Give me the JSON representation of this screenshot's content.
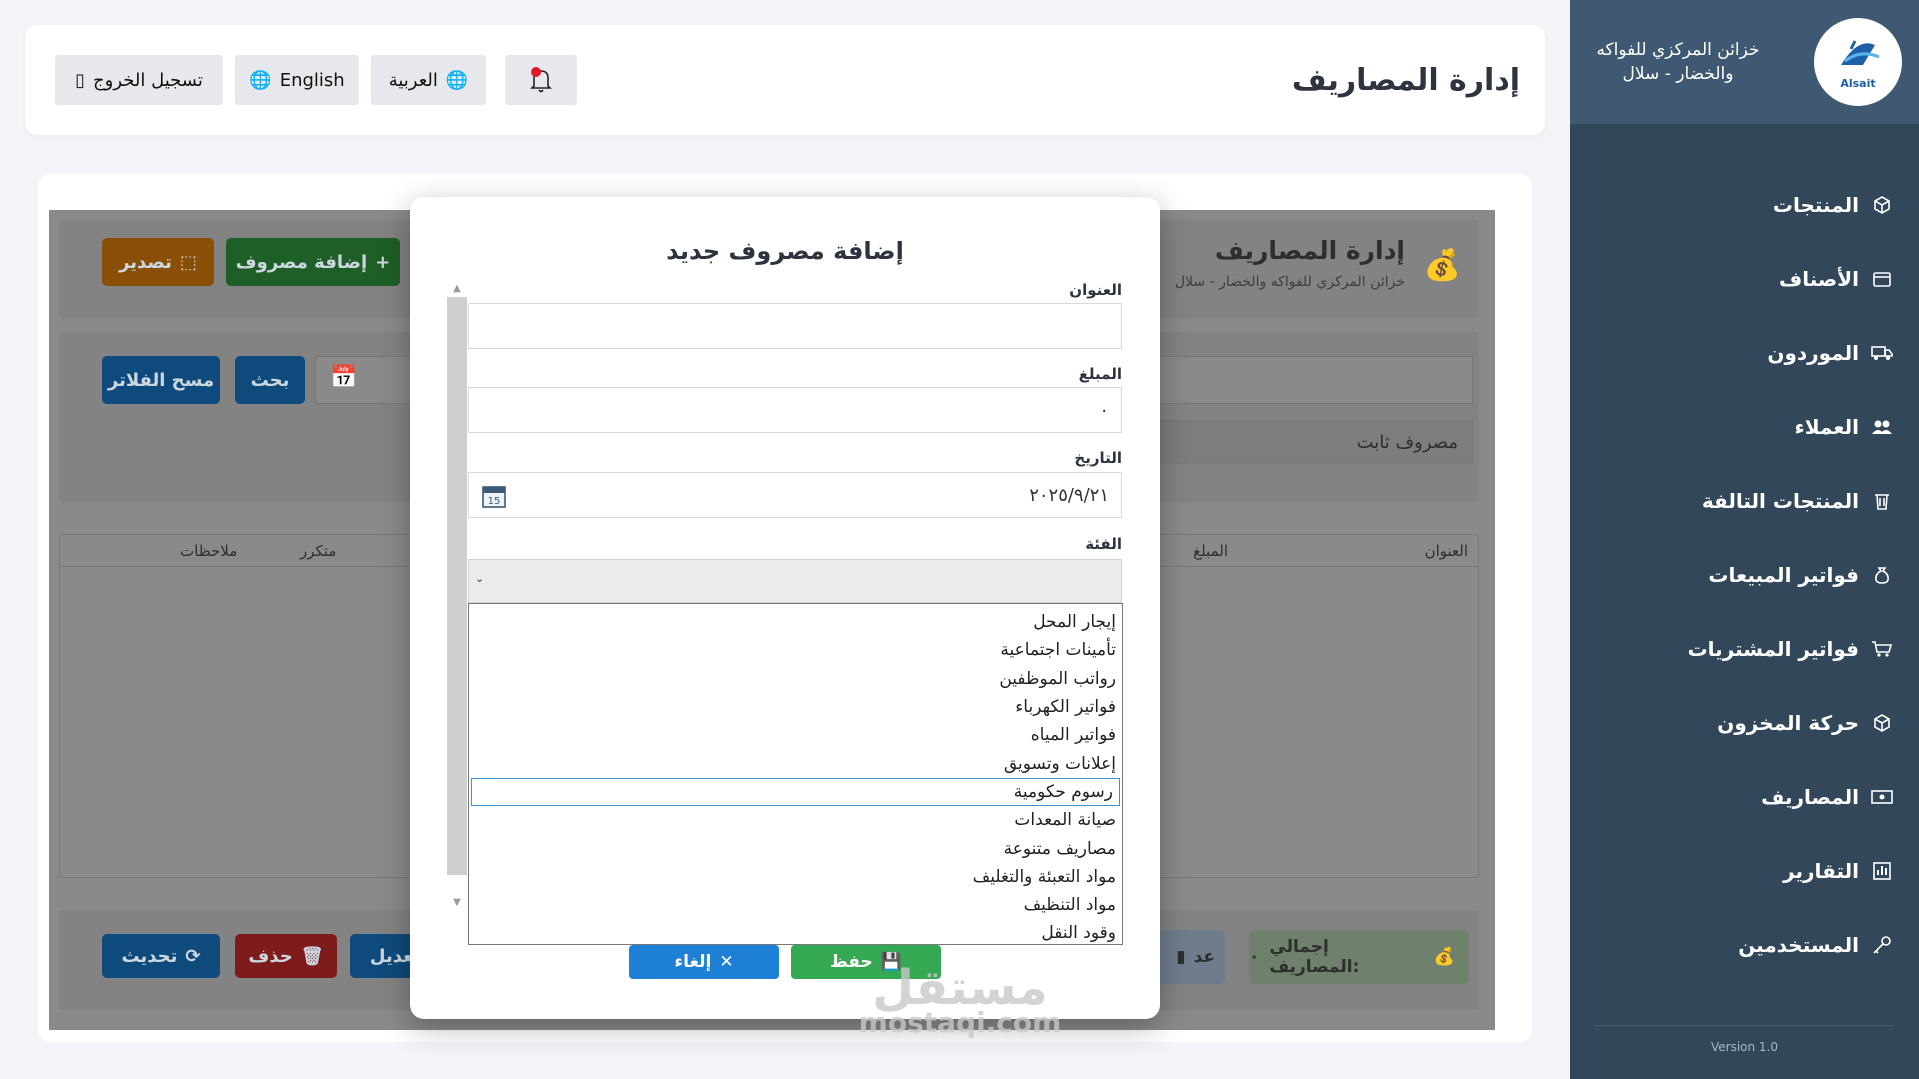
{
  "sidebar": {
    "brand": "خزائن المركزي للفواكه والخضار - سلال",
    "logo_text": "Alsait",
    "items": [
      {
        "label": "المنتجات",
        "icon": "box-icon"
      },
      {
        "label": "الأصناف",
        "icon": "folder-icon"
      },
      {
        "label": "الموردون",
        "icon": "truck-icon"
      },
      {
        "label": "العملاء",
        "icon": "users-icon"
      },
      {
        "label": "المنتجات التالفة",
        "icon": "trash-icon"
      },
      {
        "label": "فواتير المبيعات",
        "icon": "money-bag-icon"
      },
      {
        "label": "فواتير المشتريات",
        "icon": "cart-icon"
      },
      {
        "label": "حركة المخزون",
        "icon": "box-icon"
      },
      {
        "label": "المصاريف",
        "icon": "cash-icon"
      },
      {
        "label": "التقارير",
        "icon": "bar-chart-icon"
      },
      {
        "label": "المستخدمين",
        "icon": "key-icon"
      }
    ],
    "version": "Version 1.0"
  },
  "header": {
    "title": "إدارة المصاريف",
    "logout_label": "تسجيل الخروج",
    "english_label": "English",
    "arabic_label": "العربية"
  },
  "background": {
    "title": "إدارة المصاريف",
    "subtitle": "خزائن المركزي للفواكه والخضار - سلال",
    "add_label": "إضافة مصروف",
    "export_label": "تصدير",
    "search_label": "بحث",
    "clear_filters_label": "مسح الفلاتر",
    "type_value": "مصروف ثابت",
    "columns": [
      "العنوان",
      "المبلغ",
      "متكرر",
      "ملاحظات"
    ],
    "total_label": "إجمالي المصاريف:",
    "total_value": "٠",
    "count_label": "عد",
    "edit_label": "تعديل",
    "delete_label": "حذف",
    "refresh_label": "تحديث"
  },
  "modal": {
    "title": "إضافة مصروف جديد",
    "title_label": "العنوان",
    "title_value": "",
    "amount_label": "المبلغ",
    "amount_value": "٠",
    "date_label": "التاريخ",
    "date_value": "٢٠٢٥/٩/٢١",
    "category_label": "الفئة",
    "categories": [
      "إيجار المحل",
      "تأمينات اجتماعية",
      "رواتب الموظفين",
      "فواتير الكهرباء",
      "فواتير المياه",
      "إعلانات وتسويق",
      "رسوم حكومية",
      "صيانة المعدات",
      "مصاريف متنوعة",
      "مواد التعبئة والتغليف",
      "مواد التنظيف",
      "وقود النقل"
    ],
    "selected_index": 6,
    "save_label": "حفظ",
    "cancel_label": "إلغاء"
  },
  "watermark": {
    "arabic": "مستقل",
    "latin": "mostaqi.com"
  },
  "colors": {
    "sidebar": "#33475b",
    "accent_blue": "#1e7fd6",
    "green": "#2e9e48",
    "orange": "#e58a0c",
    "red": "#d93030"
  }
}
